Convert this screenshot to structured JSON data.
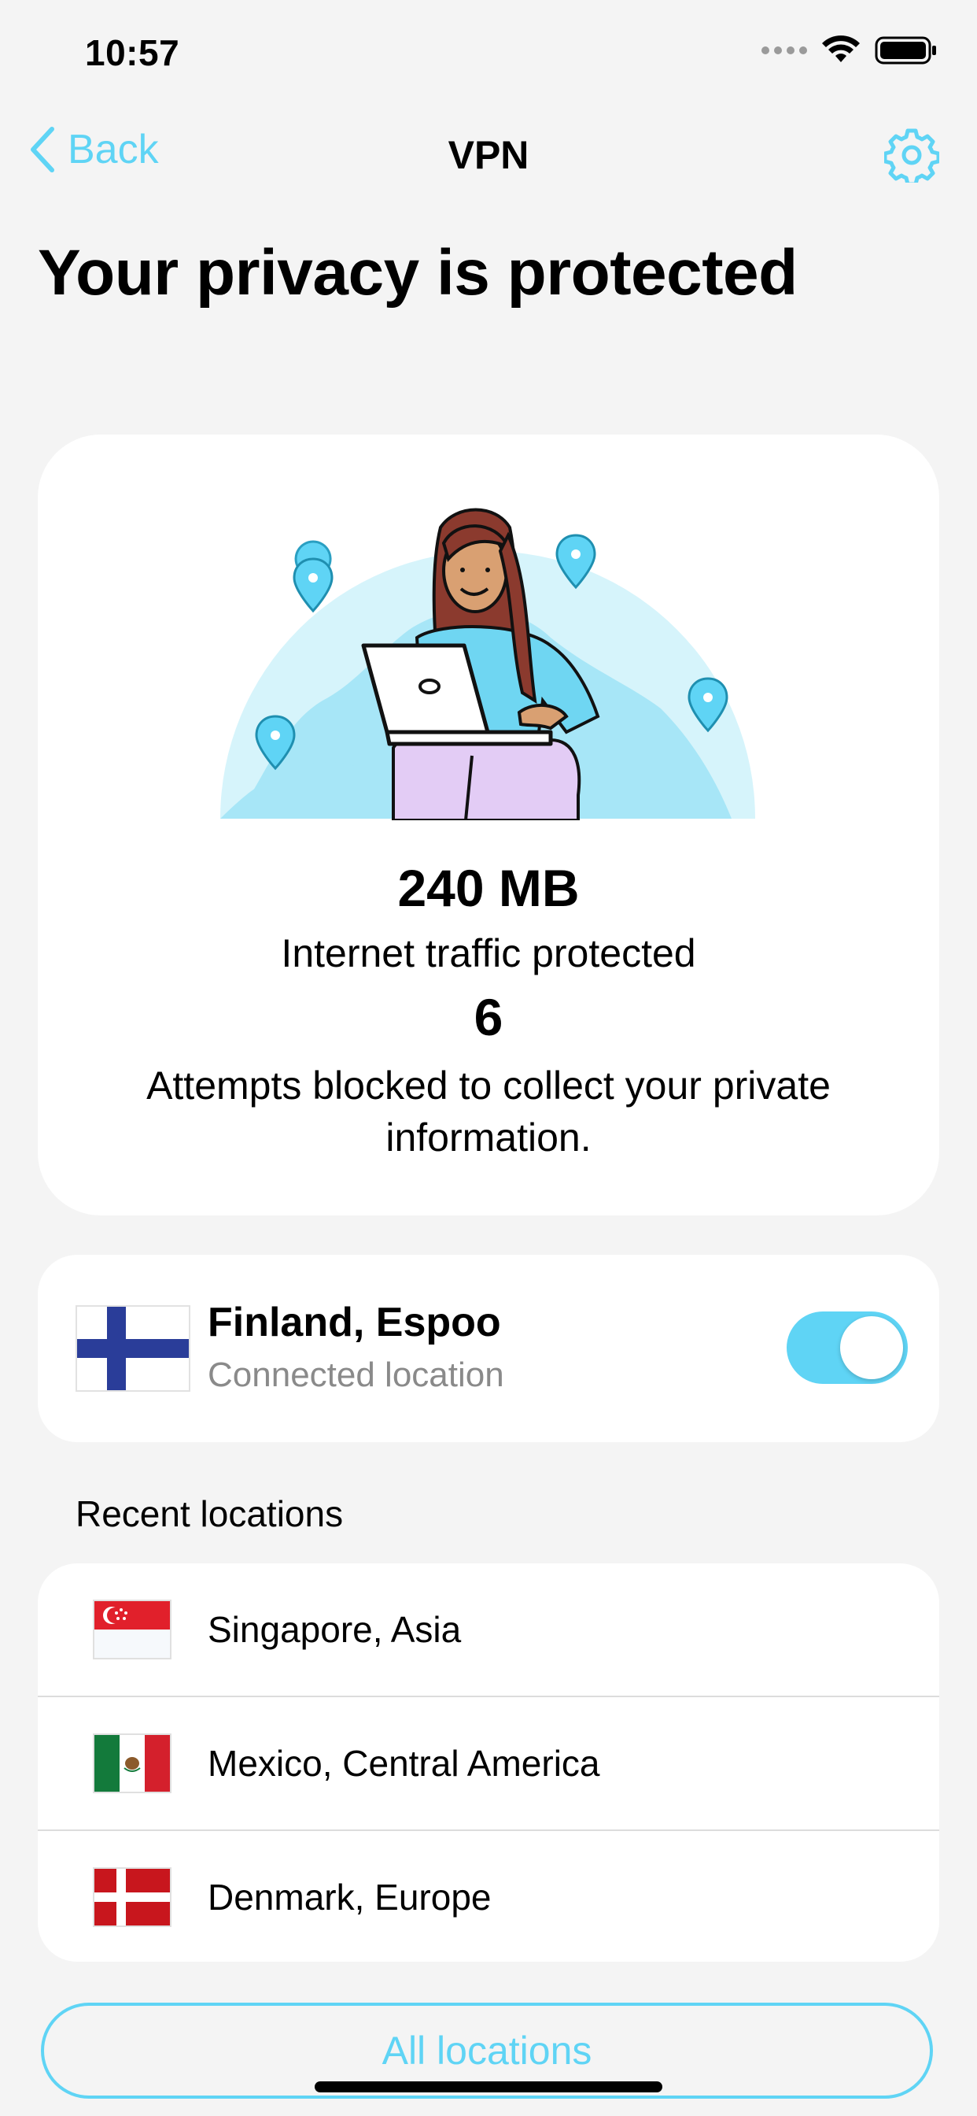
{
  "status_bar": {
    "time": "10:57"
  },
  "nav": {
    "back_label": "Back",
    "title": "VPN"
  },
  "page": {
    "title": "Your privacy is protected"
  },
  "summary": {
    "traffic_value": "240 MB",
    "traffic_label": "Internet traffic protected",
    "attempts_value": "6",
    "attempts_label": "Attempts blocked to collect your private information."
  },
  "connection": {
    "location": "Finland, Espoo",
    "status": "Connected location",
    "enabled": true
  },
  "recent": {
    "header": "Recent locations",
    "items": [
      {
        "label": "Singapore, Asia",
        "flag": "singapore-flag"
      },
      {
        "label": "Mexico, Central America",
        "flag": "mexico-flag"
      },
      {
        "label": "Denmark, Europe",
        "flag": "denmark-flag"
      }
    ]
  },
  "actions": {
    "all_locations_label": "All locations"
  },
  "colors": {
    "accent": "#5fd4f5",
    "background": "#f4f4f4",
    "card": "#ffffff"
  }
}
